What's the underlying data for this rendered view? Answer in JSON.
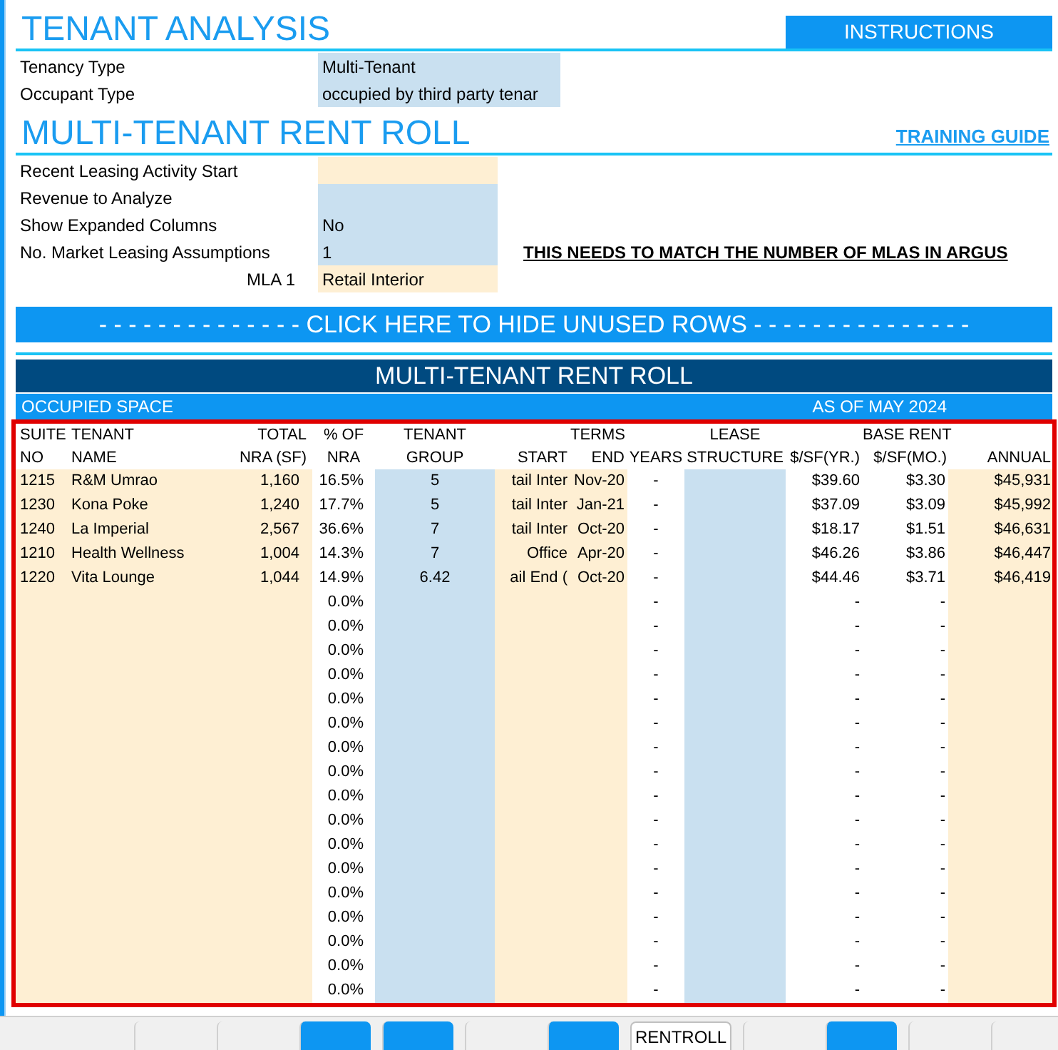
{
  "title": "TENANT ANALYSIS",
  "instructions_button": "INSTRUCTIONS",
  "tenancy_fields": [
    {
      "label": "Tenancy Type",
      "value": "Multi-Tenant",
      "kind": "blue"
    },
    {
      "label": "Occupant Type",
      "value": "occupied by third party tenar",
      "kind": "blue"
    }
  ],
  "rent_roll_title": "MULTI-TENANT RENT ROLL",
  "training_guide_link": "TRAINING GUIDE",
  "settings_fields": [
    {
      "label": "Recent Leasing Activity Start",
      "kind": "orange"
    },
    {
      "label": "Revenue to Analyze",
      "kind": "blue"
    },
    {
      "label": "Show Expanded Columns",
      "value": "No",
      "kind": "blue"
    },
    {
      "label": "No. Market Leasing Assumptions",
      "value": "1",
      "kind": "blue",
      "note": "THIS NEEDS TO MATCH THE NUMBER OF MLAS IN ARGUS"
    }
  ],
  "mla_field": {
    "label": "MLA 1",
    "value": "Retail Interior",
    "kind": "orange"
  },
  "hide_rows_button": "- - - - - - - - - - - - - - CLICK HERE TO HIDE UNUSED ROWS - - - - - - - - - - - - - - -",
  "table": {
    "banner": "MULTI-TENANT RENT ROLL",
    "subheader_left": "OCCUPIED SPACE",
    "subheader_right": "AS OF MAY 2024",
    "columns": [
      {
        "line1": "SUITE",
        "line2": "NO"
      },
      {
        "line1": "TENANT",
        "line2": "NAME"
      },
      {
        "line1": "TOTAL",
        "line2": "NRA (SF)"
      },
      {
        "line1": "% OF",
        "line2": "NRA"
      },
      {
        "line1": "TENANT",
        "line2": "GROUP"
      },
      {
        "line2": "START"
      },
      {
        "line1": "TERMS",
        "line2": "END"
      },
      {
        "line2": "YEARS"
      },
      {
        "line1": "LEASE",
        "line2": "STRUCTURE"
      },
      {
        "line2": "$/SF(YR.)"
      },
      {
        "line1": "BASE RENT",
        "line2": "$/SF(MO.)"
      },
      {
        "line2": "ANNUAL"
      }
    ],
    "rows": [
      [
        "1215",
        "R&M Umrao",
        "1,160",
        "16.5%",
        "5",
        "tail Inter",
        "Nov-20",
        "-",
        null,
        "$39.60",
        "$3.30",
        "$45,931"
      ],
      [
        "1230",
        "Kona Poke",
        "1,240",
        "17.7%",
        "5",
        "tail Inter",
        "Jan-21",
        "-",
        null,
        "$37.09",
        "$3.09",
        "$45,992"
      ],
      [
        "1240",
        "La Imperial",
        "2,567",
        "36.6%",
        "7",
        "tail Inter",
        "Oct-20",
        "-",
        null,
        "$18.17",
        "$1.51",
        "$46,631"
      ],
      [
        "1210",
        "Health Wellness",
        "1,004",
        "14.3%",
        "7",
        "Office",
        "Apr-20",
        "-",
        null,
        "$46.26",
        "$3.86",
        "$46,447"
      ],
      [
        "1220",
        "Vita Lounge",
        "1,044",
        "14.9%",
        "6.42",
        "ail End (",
        "Oct-20",
        "-",
        null,
        "$44.46",
        "$3.71",
        "$46,419"
      ],
      [
        null,
        null,
        null,
        "0.0%",
        null,
        null,
        null,
        "-",
        null,
        "-",
        "-",
        null
      ],
      [
        null,
        null,
        null,
        "0.0%",
        null,
        null,
        null,
        "-",
        null,
        "-",
        "-",
        null
      ],
      [
        null,
        null,
        null,
        "0.0%",
        null,
        null,
        null,
        "-",
        null,
        "-",
        "-",
        null
      ],
      [
        null,
        null,
        null,
        "0.0%",
        null,
        null,
        null,
        "-",
        null,
        "-",
        "-",
        null
      ],
      [
        null,
        null,
        null,
        "0.0%",
        null,
        null,
        null,
        "-",
        null,
        "-",
        "-",
        null
      ],
      [
        null,
        null,
        null,
        "0.0%",
        null,
        null,
        null,
        "-",
        null,
        "-",
        "-",
        null
      ],
      [
        null,
        null,
        null,
        "0.0%",
        null,
        null,
        null,
        "-",
        null,
        "-",
        "-",
        null
      ],
      [
        null,
        null,
        null,
        "0.0%",
        null,
        null,
        null,
        "-",
        null,
        "-",
        "-",
        null
      ],
      [
        null,
        null,
        null,
        "0.0%",
        null,
        null,
        null,
        "-",
        null,
        "-",
        "-",
        null
      ],
      [
        null,
        null,
        null,
        "0.0%",
        null,
        null,
        null,
        "-",
        null,
        "-",
        "-",
        null
      ],
      [
        null,
        null,
        null,
        "0.0%",
        null,
        null,
        null,
        "-",
        null,
        "-",
        "-",
        null
      ],
      [
        null,
        null,
        null,
        "0.0%",
        null,
        null,
        null,
        "-",
        null,
        "-",
        "-",
        null
      ],
      [
        null,
        null,
        null,
        "0.0%",
        null,
        null,
        null,
        "-",
        null,
        "-",
        "-",
        null
      ],
      [
        null,
        null,
        null,
        "0.0%",
        null,
        null,
        null,
        "-",
        null,
        "-",
        "-",
        null
      ],
      [
        null,
        null,
        null,
        "0.0%",
        null,
        null,
        null,
        "-",
        null,
        "-",
        "-",
        null
      ],
      [
        null,
        null,
        null,
        "0.0%",
        null,
        null,
        null,
        "-",
        null,
        "-",
        "-",
        null
      ],
      [
        null,
        null,
        null,
        "0.0%",
        null,
        null,
        null,
        "-",
        null,
        "-",
        "-",
        null
      ]
    ]
  },
  "sheet_tabs": [
    {
      "selected": false
    },
    {
      "selected": false
    },
    {
      "selected": false,
      "color": "#0d96f2"
    },
    {
      "selected": false,
      "color": "#0d96f2"
    },
    {
      "selected": false
    },
    {
      "selected": false,
      "color": "#0d96f2"
    },
    {
      "label": "RENTROLL",
      "selected": true
    },
    {
      "selected": false
    },
    {
      "selected": false,
      "color": "#0d96f2"
    },
    {
      "selected": false
    },
    {
      "selected": false
    }
  ]
}
